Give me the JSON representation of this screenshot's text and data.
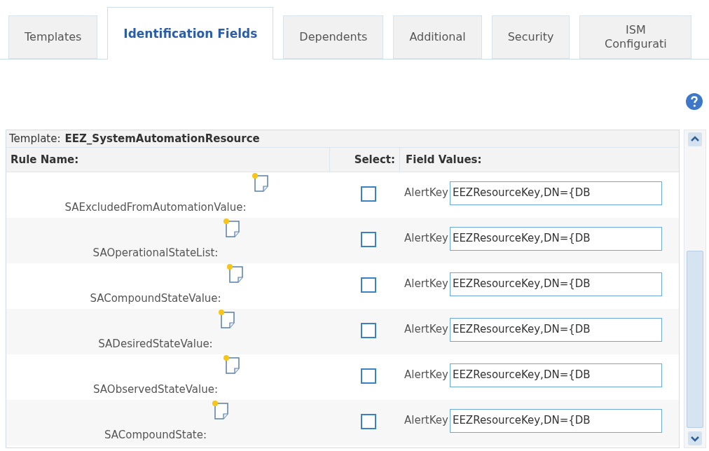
{
  "tabs": [
    {
      "label": "Templates",
      "selected": false
    },
    {
      "label": "Identification Fields",
      "selected": true
    },
    {
      "label": "Dependents",
      "selected": false
    },
    {
      "label": "Additional",
      "selected": false
    },
    {
      "label": "Security",
      "selected": false
    },
    {
      "label": "ISM Configurati",
      "selected": false
    }
  ],
  "template": {
    "label": "Template:",
    "name": "EEZ_SystemAutomationResource"
  },
  "columns": [
    "Rule Name:",
    "Select:",
    "Field Values:"
  ],
  "rows": [
    {
      "rule": "SAExcludedFromAutomationValue:",
      "checked": false,
      "field": "AlertKey",
      "value": "EEZResourceKey,DN={DB"
    },
    {
      "rule": "SAOperationalStateList:",
      "checked": false,
      "field": "AlertKey",
      "value": "EEZResourceKey,DN={DB"
    },
    {
      "rule": "SACompoundStateValue:",
      "checked": false,
      "field": "AlertKey",
      "value": "EEZResourceKey,DN={DB"
    },
    {
      "rule": "SADesiredStateValue:",
      "checked": false,
      "field": "AlertKey",
      "value": "EEZResourceKey,DN={DB"
    },
    {
      "rule": "SAObservedStateValue:",
      "checked": false,
      "field": "AlertKey",
      "value": "EEZResourceKey,DN={DB"
    },
    {
      "rule": "SACompoundState:",
      "checked": false,
      "field": "AlertKey",
      "value": "EEZResourceKey,DN={DB"
    }
  ]
}
